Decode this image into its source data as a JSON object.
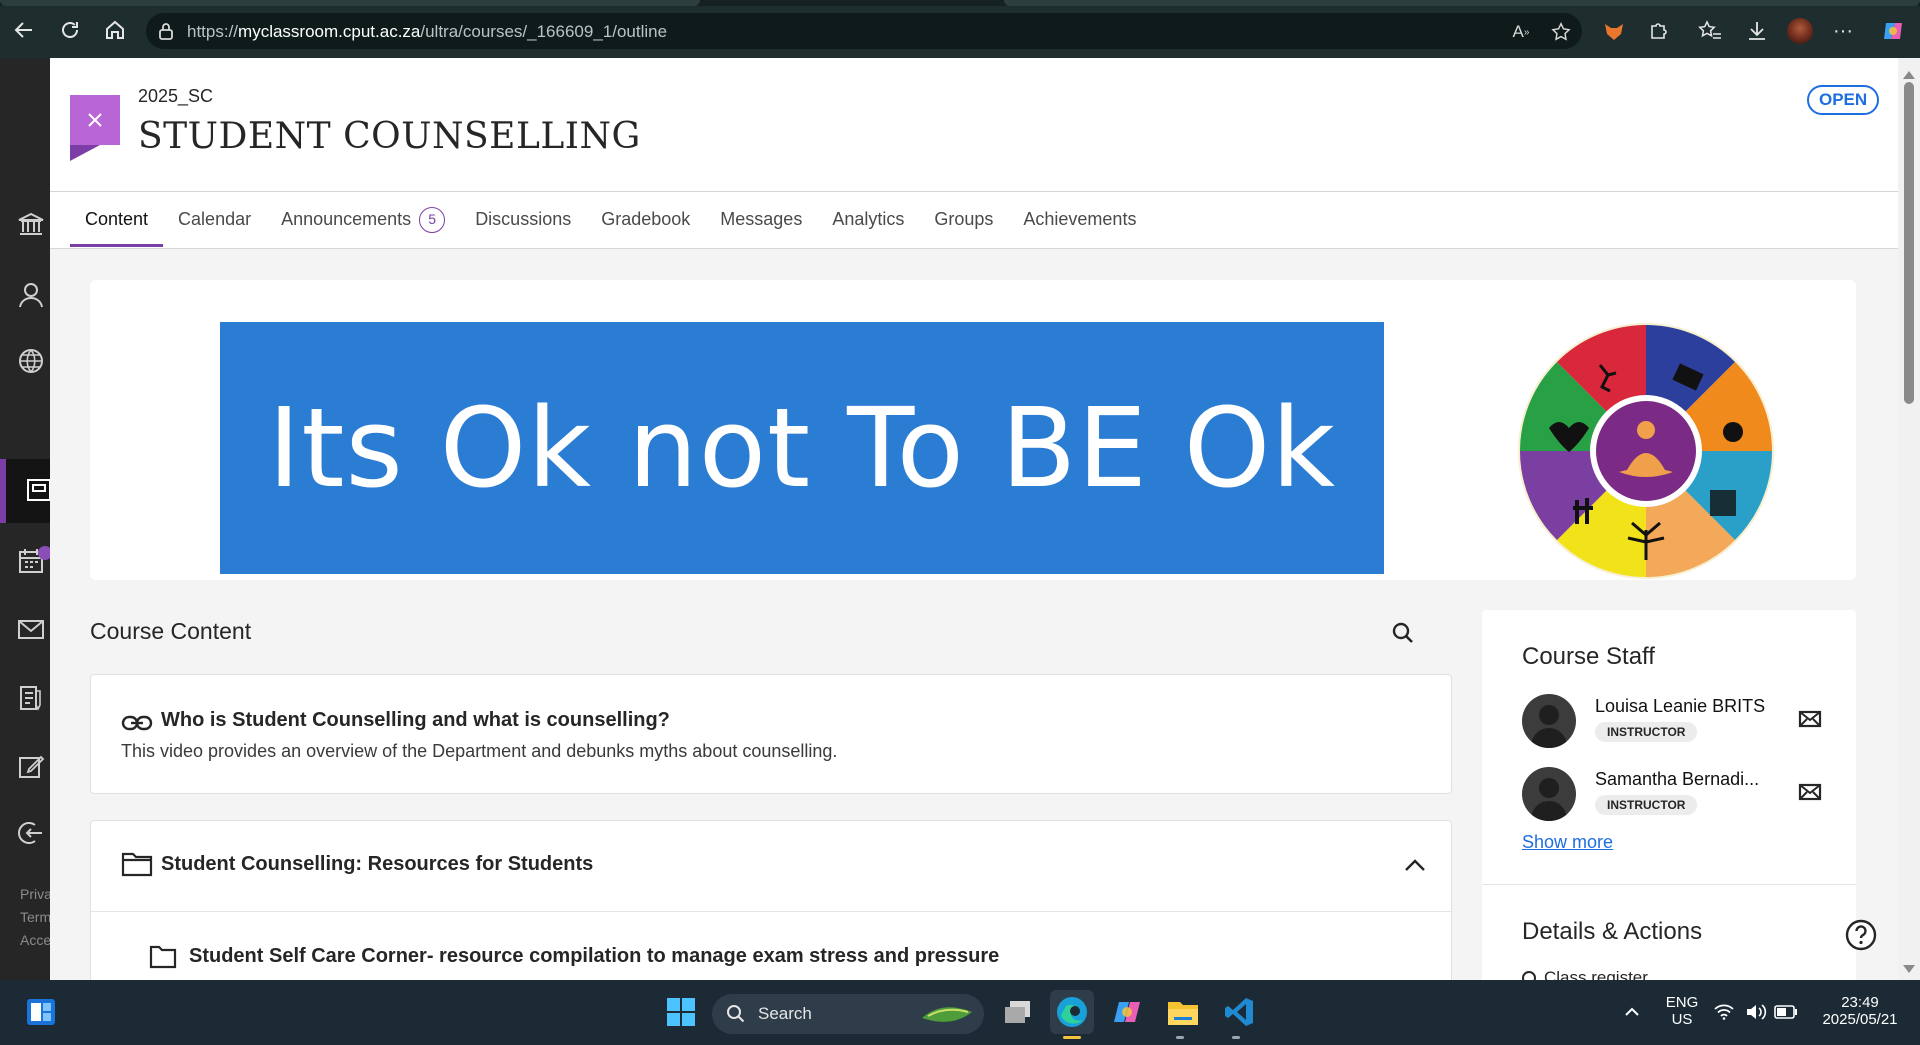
{
  "browser": {
    "url_prefix": "https://",
    "url_host": "myclassroom.cput.ac.za",
    "url_path": "/ultra/courses/_166609_1/outline"
  },
  "course": {
    "code": "2025_SC",
    "title": "STUDENT COUNSELLING",
    "status": "OPEN"
  },
  "tabs": [
    {
      "label": "Content",
      "active": true
    },
    {
      "label": "Calendar"
    },
    {
      "label": "Announcements",
      "count": "5"
    },
    {
      "label": "Discussions"
    },
    {
      "label": "Gradebook"
    },
    {
      "label": "Messages"
    },
    {
      "label": "Analytics"
    },
    {
      "label": "Groups"
    },
    {
      "label": "Achievements"
    }
  ],
  "banner": {
    "text": "Its Ok not To BE Ok",
    "color": "#2b7cd3"
  },
  "course_content": {
    "heading": "Course Content",
    "items": [
      {
        "title": "Who is Student Counselling and what is counselling?",
        "description": "This video provides an overview of the Department and debunks myths about counselling.",
        "icon": "link-icon"
      },
      {
        "title": "Student Counselling: Resources for Students",
        "icon": "folder-icon",
        "expanded": true,
        "children": [
          {
            "title": "Student Self Care Corner- resource compilation to manage exam stress and pressure",
            "icon": "folder-icon"
          }
        ]
      }
    ]
  },
  "course_staff": {
    "heading": "Course Staff",
    "members": [
      {
        "name": "Louisa Leanie BRITS",
        "role": "INSTRUCTOR"
      },
      {
        "name": "Samantha Bernadi...",
        "role": "INSTRUCTOR"
      }
    ],
    "show_more": "Show more"
  },
  "details": {
    "heading": "Details & Actions",
    "first_item": "Class register"
  },
  "rail_footer": [
    "Priva",
    "Term",
    "Acce"
  ],
  "taskbar": {
    "search_label": "Search",
    "language": "ENG",
    "region": "US",
    "time": "23:49",
    "date": "2025/05/21"
  },
  "colors": {
    "accent": "#7b3ea7",
    "link": "#1f6ee0",
    "close_flag": "#b865d6"
  }
}
